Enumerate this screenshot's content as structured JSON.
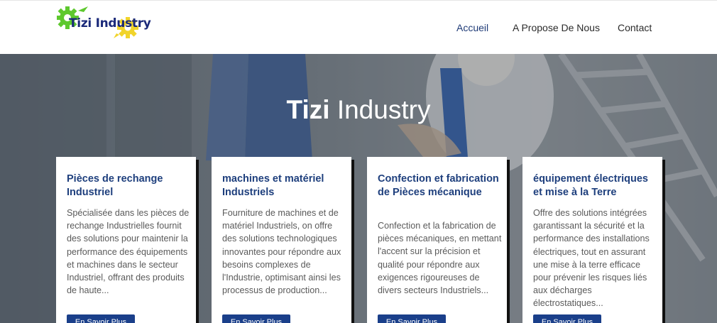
{
  "brand": {
    "logo_text": "Tizi Industry",
    "colors": {
      "gear_green": "#5ec82e",
      "gear_yellow": "#f1d42b",
      "brand_blue": "#1b2a7a"
    }
  },
  "nav": {
    "items": [
      {
        "label": "Accueil",
        "active": true
      },
      {
        "label": "A Propose De Nous",
        "active": false
      },
      {
        "label": "Contact",
        "active": false
      }
    ]
  },
  "hero": {
    "title_bold": "Tizi",
    "title_light": "Industry"
  },
  "cards": [
    {
      "title": "Pièces de rechange Industriel",
      "text": "Spécialisée dans les pièces de rechange Industrielles fournit des solutions pour maintenir la performance des équipements et machines dans le secteur Industriel, offrant des produits de haute...",
      "button": "En Savoir Plus"
    },
    {
      "title": "machines et matériel Industriels",
      "text": "Fourniture de machines et de matériel Industriels, on offre des solutions technologiques innovantes pour répondre aux besoins complexes de l'Industrie, optimisant ainsi les processus de production...",
      "button": "En Savoir Plus"
    },
    {
      "title": "Confection et fabrication de Pièces mécanique",
      "text": "Confection et la fabrication de pièces mécaniques, en mettant l'accent sur la précision et qualité pour répondre aux exigences rigoureuses de divers secteurs Industriels...",
      "button": "En Savoir Plus"
    },
    {
      "title": "équipement électriques et mise à la Terre",
      "text": "Offre des solutions intégrées garantissant la sécurité et la performance des installations électriques, tout en assurant une mise à la terre efficace pour prévenir les risques liés aux décharges électrostatiques...",
      "button": "En Savoir Plus"
    }
  ],
  "theme": {
    "card_title_color": "#1e3f7d",
    "button_color": "#1a3f8a",
    "active_nav_color": "#1f3b77"
  }
}
